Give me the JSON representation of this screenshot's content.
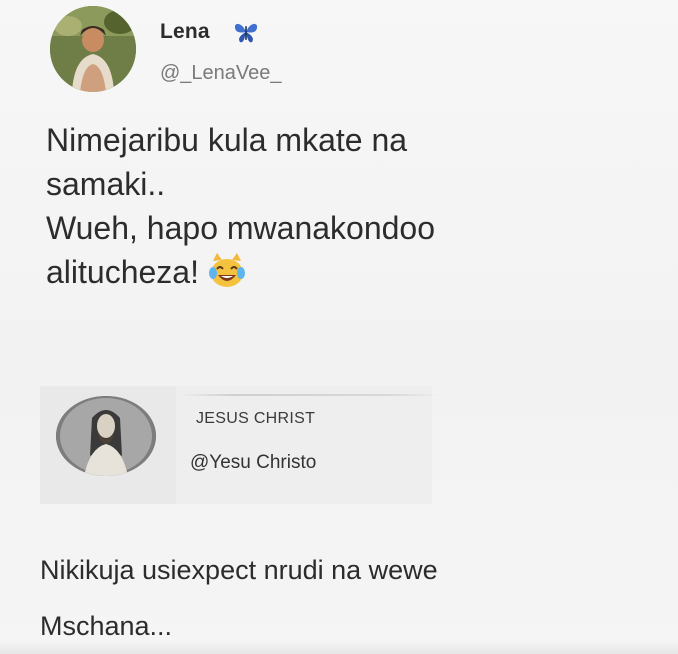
{
  "tweet": {
    "author_name": "Lena",
    "author_handle": "@_LenaVee_",
    "author_badge_icon": "butterfly-icon",
    "text_lines": [
      "Nimejaribu kula mkate na",
      "samaki..",
      "Wueh, hapo mwanakondoo",
      "alitucheza!"
    ],
    "emoji_icon": "laughing-tears-cat-emoji-icon"
  },
  "reply": {
    "author_name": "JESUS CHRIST",
    "author_handle": "@Yesu Christo",
    "text_lines": [
      "Nikikuja usiexpect nrudi na wewe",
      "Mschana..."
    ]
  },
  "colors": {
    "background": "#f4f4f4",
    "text": "#2c2c2c",
    "handle": "#7a7a7a",
    "butterfly": "#3f6fd0"
  }
}
